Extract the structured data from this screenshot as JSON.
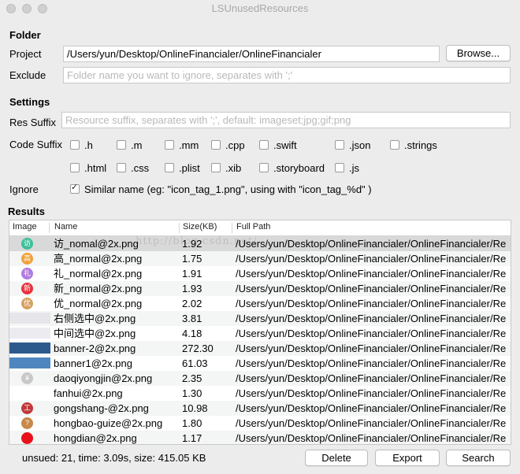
{
  "window": {
    "title": "LSUnusedResources"
  },
  "folder": {
    "heading": "Folder",
    "project_label": "Project",
    "project_value": "/Users/yun/Desktop/OnlineFinancialer/OnlineFinancialer",
    "browse_label": "Browse...",
    "exclude_label": "Exclude",
    "exclude_placeholder": "Folder name you want to ignore, separates with ';'"
  },
  "settings": {
    "heading": "Settings",
    "res_suffix_label": "Res Suffix",
    "res_suffix_placeholder": "Resource suffix, separates with ';', default: imageset;jpg;gif;png",
    "code_suffix_label": "Code Suffix",
    "code_suffixes": [
      {
        "label": ".h",
        "checked": false
      },
      {
        "label": ".m",
        "checked": true
      },
      {
        "label": ".mm",
        "checked": true
      },
      {
        "label": ".cpp",
        "checked": false
      },
      {
        "label": ".swift",
        "checked": true
      },
      {
        "label": ".json",
        "checked": false
      },
      {
        "label": ".strings",
        "checked": false
      },
      {
        "label": ".html",
        "checked": false
      },
      {
        "label": ".css",
        "checked": false
      },
      {
        "label": ".plist",
        "checked": true
      },
      {
        "label": ".xib",
        "checked": true
      },
      {
        "label": ".storyboard",
        "checked": true
      },
      {
        "label": ".js",
        "checked": false
      }
    ],
    "ignore_label": "Ignore",
    "ignore_option": "Similar name (eg: \"icon_tag_1.png\", using with \"icon_tag_%d\" )",
    "ignore_checked": true
  },
  "results": {
    "heading": "Results",
    "columns": [
      "Image",
      "Name",
      "Size(KB)",
      "Full Path"
    ],
    "watermark": "http://blog.csdn.net/",
    "rows": [
      {
        "icon": "fang-icon",
        "glyph": "访",
        "color": "#3dbf9a",
        "name": "访_nomal@2x.png",
        "size": "1.92",
        "path": "/Users/yun/Desktop/OnlineFinancialer/OnlineFinancialer/Re"
      },
      {
        "icon": "gao-icon",
        "glyph": "高",
        "color": "#f0a13a",
        "name": "高_normal@2x.png",
        "size": "1.75",
        "path": "/Users/yun/Desktop/OnlineFinancialer/OnlineFinancialer/Re"
      },
      {
        "icon": "li-icon",
        "glyph": "礼",
        "color": "#b07ae0",
        "name": "礼_normal@2x.png",
        "size": "1.91",
        "path": "/Users/yun/Desktop/OnlineFinancialer/OnlineFinancialer/Re"
      },
      {
        "icon": "xin-icon",
        "glyph": "新",
        "color": "#e8303a",
        "name": "新_normal@2x.png",
        "size": "1.93",
        "path": "/Users/yun/Desktop/OnlineFinancialer/OnlineFinancialer/Re"
      },
      {
        "icon": "you-icon",
        "glyph": "优",
        "color": "#d6a060",
        "name": "优_normal@2x.png",
        "size": "2.02",
        "path": "/Users/yun/Desktop/OnlineFinancialer/OnlineFinancialer/Re"
      },
      {
        "icon": "right-selected-image-icon",
        "glyph": "",
        "color": "#e6e6ea",
        "wide": true,
        "name": "右侧选中@2x.png",
        "size": "3.81",
        "path": "/Users/yun/Desktop/OnlineFinancialer/OnlineFinancialer/Re"
      },
      {
        "icon": "middle-selected-image-icon",
        "glyph": "",
        "color": "#ececf0",
        "wide": true,
        "name": "中间选中@2x.png",
        "size": "4.18",
        "path": "/Users/yun/Desktop/OnlineFinancialer/OnlineFinancialer/Re"
      },
      {
        "icon": "banner-thumbnail-icon",
        "glyph": "",
        "color": "#2d5a8c",
        "wide": true,
        "name": "banner-2@2x.png",
        "size": "272.30",
        "path": "/Users/yun/Desktop/OnlineFinancialer/OnlineFinancialer/Re"
      },
      {
        "icon": "banner-thumbnail-icon",
        "glyph": "",
        "color": "#4f86c0",
        "wide": true,
        "name": "banner1@2x.png",
        "size": "61.03",
        "path": "/Users/yun/Desktop/OnlineFinancialer/OnlineFinancialer/Re"
      },
      {
        "icon": "yen-icon",
        "glyph": "¥",
        "color": "#c8c8c8",
        "name": "daoqiyongjin@2x.png",
        "size": "2.35",
        "path": "/Users/yun/Desktop/OnlineFinancialer/OnlineFinancialer/Re"
      },
      {
        "icon": "blank-icon",
        "glyph": "",
        "color": "#ffffff",
        "name": "fanhui@2x.png",
        "size": "1.30",
        "path": "/Users/yun/Desktop/OnlineFinancialer/OnlineFinancialer/Re"
      },
      {
        "icon": "gongshang-icon",
        "glyph": "工",
        "color": "#c0383a",
        "name": "gongshang-@2x.png",
        "size": "10.98",
        "path": "/Users/yun/Desktop/OnlineFinancialer/OnlineFinancialer/Re"
      },
      {
        "icon": "question-icon",
        "glyph": "?",
        "color": "#c8884a",
        "name": "hongbao-guize@2x.png",
        "size": "1.80",
        "path": "/Users/yun/Desktop/OnlineFinancialer/OnlineFinancialer/Re"
      },
      {
        "icon": "red-dot-icon",
        "glyph": "",
        "color": "#e8101a",
        "name": "hongdian@2x.png",
        "size": "1.17",
        "path": "/Users/yun/Desktop/OnlineFinancialer/OnlineFinancialer/Re"
      }
    ]
  },
  "footer": {
    "status": "unsued: 21, time: 3.09s, size: 415.05 KB",
    "delete_label": "Delete",
    "export_label": "Export",
    "search_label": "Search"
  }
}
